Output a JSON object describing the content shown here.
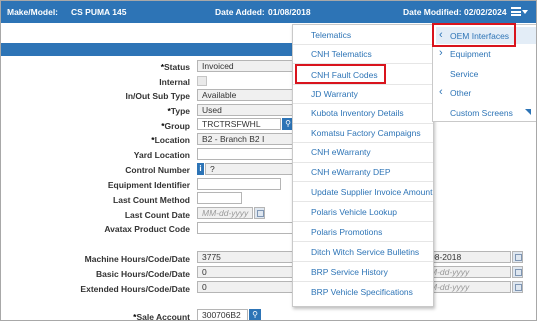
{
  "header": {
    "make_model_label": "Make/Model:",
    "make_model_value": "CS PUMA 145",
    "date_added_label": "Date Added:",
    "date_added_value": "01/08/2018",
    "date_modified_label": "Date Modified:",
    "date_modified_value": "02/02/2024"
  },
  "form": {
    "status": {
      "label": "Status",
      "value": "Invoiced"
    },
    "internal": {
      "label": "Internal"
    },
    "sub_type": {
      "label": "In/Out Sub Type",
      "value": "Available"
    },
    "type": {
      "label": "Type",
      "value": "Used"
    },
    "group": {
      "label": "Group",
      "value": "TRCTRSFWHL"
    },
    "location": {
      "label": "Location",
      "value": "B2 - Branch B2 I"
    },
    "yard_location": {
      "label": "Yard Location"
    },
    "control_number": {
      "label": "Control Number",
      "value": "?",
      "info_button": "i"
    },
    "equipment_identifier": {
      "label": "Equipment Identifier"
    },
    "last_count_method": {
      "label": "Last Count Method"
    },
    "last_count_date": {
      "label": "Last Count Date",
      "placeholder": "MM-dd-yyyy"
    },
    "avatax_product_code": {
      "label": "Avatax Product Code"
    },
    "machine_hours": {
      "label": "Machine Hours/Code/Date",
      "value": "3775",
      "date_fragment": "08-2018"
    },
    "basic_hours": {
      "label": "Basic Hours/Code/Date",
      "value": "0",
      "date_placeholder": "M-dd-yyyy"
    },
    "extended_hours": {
      "label": "Extended Hours/Code/Date",
      "value": "0",
      "date_placeholder": "M-dd-yyyy"
    },
    "sale_account": {
      "label": "Sale Account",
      "value": "300706B2"
    }
  },
  "menu": {
    "items": [
      "Telematics",
      "CNH Telematics",
      "CNH Fault Codes",
      "JD Warranty",
      "Kubota Inventory Details",
      "Komatsu Factory Campaigns",
      "CNH eWarranty",
      "CNH eWarranty DEP",
      "Update Supplier Invoice Amount",
      "Polaris Vehicle Lookup",
      "Polaris Promotions",
      "Ditch Witch Service Bulletins",
      "BRP Service History",
      "BRP Vehicle Specifications"
    ]
  },
  "panel": {
    "oem_interfaces": "OEM Interfaces",
    "equipment": "Equipment",
    "service": "Service",
    "other": "Other",
    "custom_screens": "Custom Screens"
  },
  "colors": {
    "accent": "#2d74b6",
    "highlight_box": "#d9141d"
  },
  "icons": {
    "menu": "hamburger-icon",
    "search": "search-icon",
    "calendar": "calendar-icon",
    "back": "chevron-left-icon",
    "forward": "chevron-right-icon"
  }
}
